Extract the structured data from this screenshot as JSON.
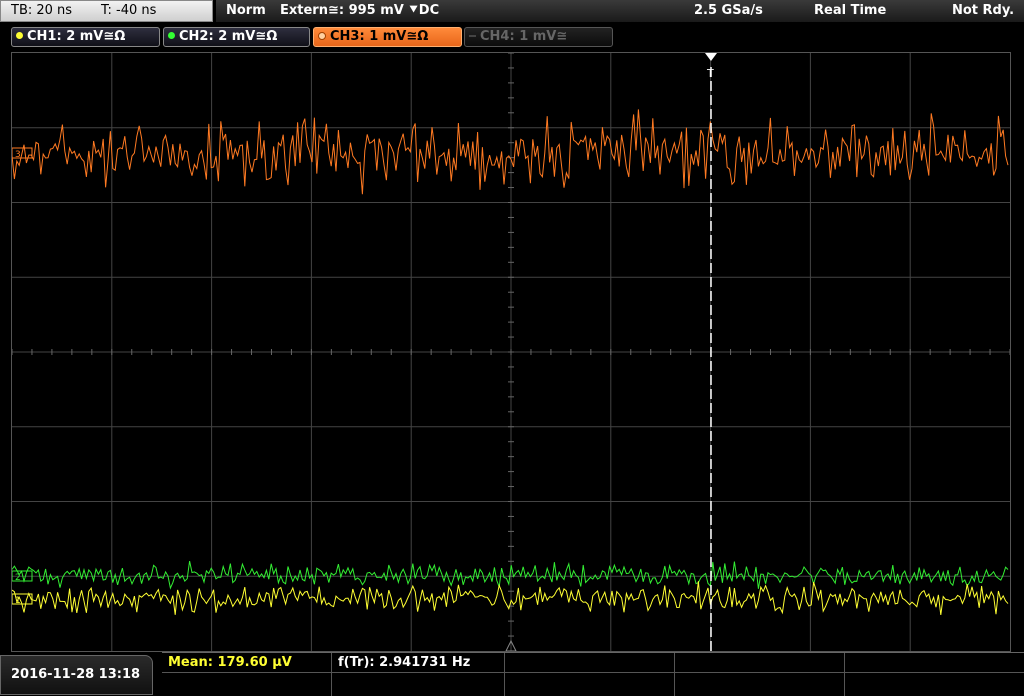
{
  "timebase": {
    "tb": "TB: 20 ns",
    "t": "T: -40 ns"
  },
  "acquisition": {
    "mode": "Norm",
    "trigger": "Extern≅: 995 mV ⯆DC",
    "sample_rate": "2.5 GSa/s",
    "acq_type": "Real Time",
    "status": "Not Rdy."
  },
  "channels": [
    {
      "label": "CH1: 2 mV≅Ω",
      "color": "#ffff33",
      "active": true
    },
    {
      "label": "CH2: 2 mV≅Ω",
      "color": "#33ff33",
      "active": true
    },
    {
      "label": "CH3: 1 mV≅Ω",
      "color": "#ff7a22",
      "active": true
    },
    {
      "label": "CH4: 1 mV≅",
      "color": "#555555",
      "active": false
    }
  ],
  "markers": {
    "ch3": "3",
    "ch2": "2",
    "ch1": "1",
    "trigger": "T"
  },
  "measurements": {
    "mean": "Mean: 179.60 µV",
    "freq": "f(Tr): 2.941731 Hz"
  },
  "datetime": "2016-11-28 13:18",
  "colors": {
    "ch1": "#ffff33",
    "ch2": "#33ee33",
    "ch3": "#ff7a22",
    "grid": "#444444"
  }
}
